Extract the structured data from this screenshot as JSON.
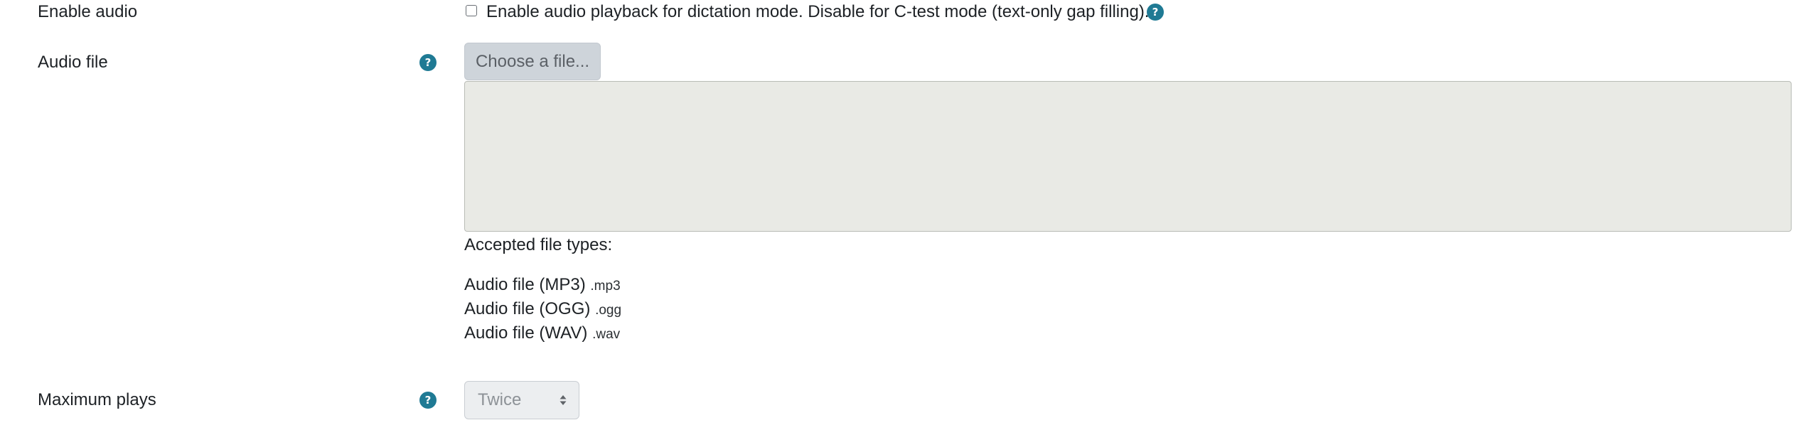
{
  "enable_audio": {
    "label": "Enable audio",
    "checkbox_text": "Enable audio playback for dictation mode. Disable for C-test mode (text-only gap filling).",
    "checked": false,
    "help_icon": "question-circle-icon",
    "help_glyph": "?"
  },
  "audio_file": {
    "label": "Audio file",
    "help_icon": "question-circle-icon",
    "help_glyph": "?",
    "choose_button": "Choose a file...",
    "accepted_title": "Accepted file types:",
    "file_types": [
      {
        "name": "Audio file (MP3)",
        "ext": ".mp3"
      },
      {
        "name": "Audio file (OGG)",
        "ext": ".ogg"
      },
      {
        "name": "Audio file (WAV)",
        "ext": ".wav"
      }
    ]
  },
  "maximum_plays": {
    "label": "Maximum plays",
    "help_icon": "question-circle-icon",
    "help_glyph": "?",
    "selected": "Twice",
    "arrow_icon": "sort-arrows-icon"
  },
  "colors": {
    "help_icon": "#1f7a94",
    "dropzone": "#e9eae5",
    "button_disabled": "#ced4da",
    "text": "#1d2125"
  }
}
